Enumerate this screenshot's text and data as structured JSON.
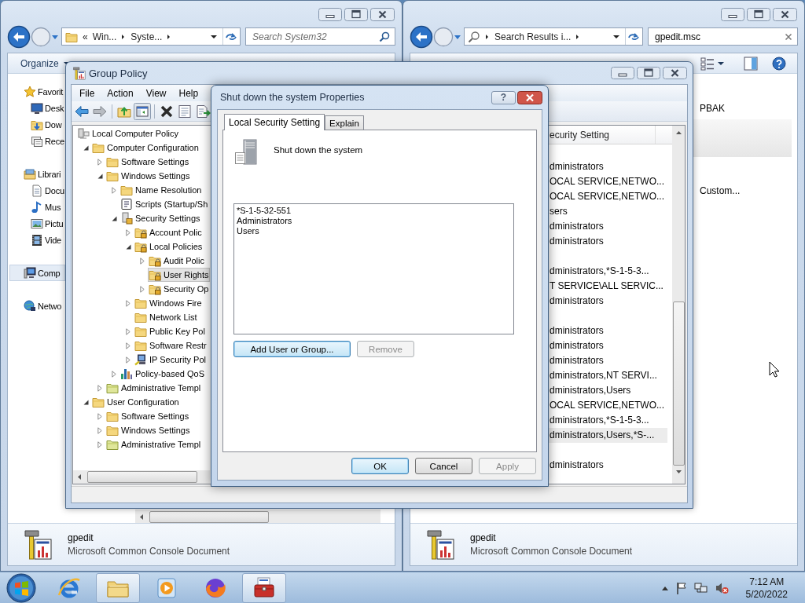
{
  "left_explorer": {
    "kind": "folder",
    "address_overflow": "«",
    "address": [
      "Win...",
      "Syste..."
    ],
    "search": {
      "placeholder": "Search System32"
    },
    "toolbar": [
      "Organize"
    ],
    "nav": [
      {
        "label": "Favorit",
        "kind": "favorites",
        "selected": false,
        "children": [
          {
            "label": "Desk",
            "kind": "desktop",
            "selected": false
          },
          {
            "label": "Dow",
            "kind": "downloads",
            "selected": false
          },
          {
            "label": "Rece",
            "kind": "recent",
            "selected": false
          }
        ]
      },
      {
        "label": "Librari",
        "kind": "libraries",
        "selected": false,
        "children": [
          {
            "label": "Docu",
            "kind": "documents",
            "selected": false
          },
          {
            "label": "Mus",
            "kind": "music",
            "selected": false
          },
          {
            "label": "Pictu",
            "kind": "pictures",
            "selected": false
          },
          {
            "label": "Vide",
            "kind": "videos",
            "selected": false
          }
        ]
      },
      {
        "label": "Comp",
        "kind": "computer",
        "selected": true
      },
      {
        "label": "Netwo",
        "kind": "network",
        "selected": false
      }
    ],
    "details": {
      "name": "gpedit",
      "type": "Microsoft Common Console Document"
    }
  },
  "right_explorer": {
    "kind": "search-results",
    "address": [
      "Search Results i..."
    ],
    "search": {
      "value": "gpedit.msc"
    },
    "content": [
      "PBAK",
      "Custom..."
    ],
    "details": {
      "name": "gpedit",
      "type": "Microsoft Common Console Document"
    }
  },
  "group_policy": {
    "title": "Group Policy",
    "menu": [
      "File",
      "Action",
      "View",
      "Help"
    ],
    "toolbar": [
      {
        "kind": "back",
        "pressed": false
      },
      {
        "kind": "forward",
        "pressed": false
      },
      {
        "kind": "up",
        "pressed": false
      },
      {
        "kind": "console-tree",
        "pressed": true
      },
      {
        "kind": "delete",
        "pressed": false
      },
      {
        "kind": "properties",
        "pressed": false
      },
      {
        "kind": "export",
        "pressed": false
      }
    ],
    "tree": [
      {
        "label": "Local Computer Policy",
        "kind": "policy",
        "expandable": false,
        "selected": false,
        "children": [
          {
            "label": "Computer Configuration",
            "kind": "folder",
            "expandable": true,
            "expanded": true,
            "selected": false,
            "children": [
              {
                "label": "Software Settings",
                "kind": "folder",
                "expandable": true,
                "expanded": false,
                "selected": false
              },
              {
                "label": "Windows Settings",
                "kind": "folder",
                "expandable": true,
                "expanded": true,
                "selected": false,
                "children": [
                  {
                    "label": "Name Resolution",
                    "kind": "folder",
                    "expandable": true,
                    "expanded": false,
                    "selected": false
                  },
                  {
                    "label": "Scripts (Startup/Sh",
                    "kind": "scripts",
                    "expandable": false,
                    "selected": false
                  },
                  {
                    "label": "Security Settings",
                    "kind": "security",
                    "expandable": true,
                    "expanded": true,
                    "selected": false,
                    "children": [
                      {
                        "label": "Account Polic",
                        "kind": "secured-folder",
                        "expandable": true,
                        "expanded": false,
                        "selected": false
                      },
                      {
                        "label": "Local Policies",
                        "kind": "secured-folder",
                        "expandable": true,
                        "expanded": true,
                        "selected": false,
                        "children": [
                          {
                            "label": "Audit Polic",
                            "kind": "secured-folder",
                            "expandable": true,
                            "expanded": false,
                            "selected": false
                          },
                          {
                            "label": "User Rights",
                            "kind": "secured-folder",
                            "expandable": false,
                            "selected": true
                          },
                          {
                            "label": "Security Op",
                            "kind": "secured-folder",
                            "expandable": true,
                            "expanded": false,
                            "selected": false
                          }
                        ]
                      },
                      {
                        "label": "Windows Fire",
                        "kind": "folder",
                        "expandable": true,
                        "expanded": false,
                        "selected": false
                      },
                      {
                        "label": "Network List",
                        "kind": "folder",
                        "expandable": false,
                        "selected": false
                      },
                      {
                        "label": "Public Key Pol",
                        "kind": "folder",
                        "expandable": true,
                        "expanded": false,
                        "selected": false
                      },
                      {
                        "label": "Software Restr",
                        "kind": "folder",
                        "expandable": true,
                        "expanded": false,
                        "selected": false
                      },
                      {
                        "label": "IP Security Pol",
                        "kind": "ip-security",
                        "expandable": true,
                        "expanded": false,
                        "selected": false
                      }
                    ]
                  },
                  {
                    "label": "Policy-based QoS",
                    "kind": "qos",
                    "expandable": true,
                    "expanded": false,
                    "selected": false
                  }
                ]
              },
              {
                "label": "Administrative Templ",
                "kind": "template-folder",
                "expandable": true,
                "expanded": false,
                "selected": false
              }
            ]
          },
          {
            "label": "User Configuration",
            "kind": "folder",
            "expandable": true,
            "expanded": true,
            "selected": false,
            "children": [
              {
                "label": "Software Settings",
                "kind": "folder",
                "expandable": true,
                "expanded": false,
                "selected": false
              },
              {
                "label": "Windows Settings",
                "kind": "folder",
                "expandable": true,
                "expanded": false,
                "selected": false
              },
              {
                "label": "Administrative Templ",
                "kind": "template-folder",
                "expandable": true,
                "expanded": false,
                "selected": false
              }
            ]
          }
        ]
      }
    ],
    "column": "ecurity Setting",
    "rows": [
      {
        "selected": false
      },
      {
        "setting": "dministrators",
        "selected": false
      },
      {
        "setting": "OCAL SERVICE,NETWO...",
        "selected": false
      },
      {
        "setting": "OCAL SERVICE,NETWO...",
        "selected": false
      },
      {
        "setting": "sers",
        "selected": false
      },
      {
        "setting": "dministrators",
        "selected": false
      },
      {
        "setting": "dministrators",
        "selected": false
      },
      {
        "selected": false
      },
      {
        "setting": "dministrators,*S-1-5-3...",
        "selected": false
      },
      {
        "setting": "T SERVICE\\ALL SERVIC...",
        "selected": false
      },
      {
        "setting": "dministrators",
        "selected": false
      },
      {
        "selected": false
      },
      {
        "setting": "dministrators",
        "selected": false
      },
      {
        "setting": "dministrators",
        "selected": false
      },
      {
        "setting": "dministrators",
        "selected": false
      },
      {
        "setting": "dministrators,NT SERVI...",
        "selected": false
      },
      {
        "setting": "dministrators,Users",
        "selected": false
      },
      {
        "setting": "OCAL SERVICE,NETWO...",
        "selected": false
      },
      {
        "setting": "dministrators,*S-1-5-3...",
        "selected": false
      },
      {
        "setting": "dministrators,Users,*S-...",
        "selected": true
      },
      {
        "selected": false
      },
      {
        "setting": "dministrators",
        "selected": false
      }
    ]
  },
  "dialog": {
    "title": "Shut down the system Properties",
    "help": "?",
    "tabs": [
      {
        "label": "Local Security Setting",
        "selected": true
      },
      {
        "label": "Explain",
        "selected": false
      }
    ],
    "policy": "Shut down the system",
    "members": [
      "*S-1-5-32-551",
      "Administrators",
      "Users"
    ],
    "member_buttons": [
      {
        "label": "Add User or Group...",
        "disabled": false,
        "focused": true
      },
      {
        "label": "Remove",
        "disabled": true,
        "focused": false
      }
    ],
    "buttons": [
      {
        "label": "OK",
        "disabled": false,
        "focused": true
      },
      {
        "label": "Cancel",
        "disabled": false,
        "focused": false
      },
      {
        "label": "Apply",
        "disabled": true,
        "focused": false
      }
    ]
  },
  "taskbar": {
    "apps": [
      {
        "kind": "browser-e",
        "active": false
      },
      {
        "kind": "folders",
        "active": true
      },
      {
        "kind": "media",
        "active": false
      },
      {
        "kind": "browser-fox",
        "active": false
      },
      {
        "kind": "toolbox",
        "active": true
      }
    ],
    "muted": true,
    "time": "7:12 AM",
    "date": "5/20/2022"
  }
}
